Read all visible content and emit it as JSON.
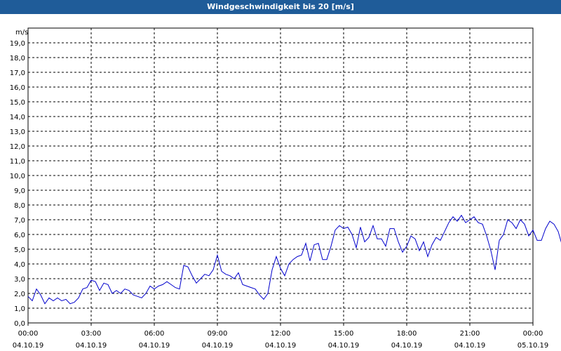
{
  "window": {
    "title": "Windgeschwindigkeit bis 20 [m/s]"
  },
  "colors": {
    "titlebar": "#1f5c99",
    "line": "#0000cc",
    "grid": "#000000"
  },
  "chart_data": {
    "type": "line",
    "title": "Windgeschwindigkeit bis 20 [m/s]",
    "ylabel": "m/s",
    "ylim": [
      0,
      20
    ],
    "y_ticks": [
      "0,0",
      "1,0",
      "2,0",
      "3,0",
      "4,0",
      "5,0",
      "6,0",
      "7,0",
      "8,0",
      "9,0",
      "10,0",
      "11,0",
      "12,0",
      "13,0",
      "14,0",
      "15,0",
      "16,0",
      "17,0",
      "18,0",
      "19,0"
    ],
    "x_range_hours": [
      0,
      24
    ],
    "x_ticks": [
      {
        "time": "00:00",
        "date": "04.10.19"
      },
      {
        "time": "03:00",
        "date": "04.10.19"
      },
      {
        "time": "06:00",
        "date": "04.10.19"
      },
      {
        "time": "09:00",
        "date": "04.10.19"
      },
      {
        "time": "12:00",
        "date": "04.10.19"
      },
      {
        "time": "15:00",
        "date": "04.10.19"
      },
      {
        "time": "18:00",
        "date": "04.10.19"
      },
      {
        "time": "21:00",
        "date": "04.10.19"
      },
      {
        "time": "00:00",
        "date": "05.10.19"
      }
    ],
    "grid": true,
    "series": [
      {
        "values": [
          [
            0.0,
            1.8
          ],
          [
            0.2,
            1.5
          ],
          [
            0.4,
            2.3
          ],
          [
            0.6,
            1.9
          ],
          [
            0.8,
            1.3
          ],
          [
            1.0,
            1.7
          ],
          [
            1.2,
            1.5
          ],
          [
            1.4,
            1.7
          ],
          [
            1.6,
            1.5
          ],
          [
            1.8,
            1.6
          ],
          [
            2.0,
            1.3
          ],
          [
            2.2,
            1.4
          ],
          [
            2.4,
            1.7
          ],
          [
            2.6,
            2.3
          ],
          [
            2.8,
            2.4
          ],
          [
            3.0,
            2.9
          ],
          [
            3.2,
            2.8
          ],
          [
            3.4,
            2.2
          ],
          [
            3.6,
            2.7
          ],
          [
            3.8,
            2.6
          ],
          [
            4.0,
            2.0
          ],
          [
            4.2,
            2.2
          ],
          [
            4.4,
            2.0
          ],
          [
            4.6,
            2.3
          ],
          [
            4.8,
            2.2
          ],
          [
            5.0,
            1.9
          ],
          [
            5.2,
            1.8
          ],
          [
            5.4,
            1.7
          ],
          [
            5.6,
            2.0
          ],
          [
            5.8,
            2.5
          ],
          [
            6.0,
            2.3
          ],
          [
            6.2,
            2.5
          ],
          [
            6.4,
            2.6
          ],
          [
            6.6,
            2.8
          ],
          [
            6.8,
            2.6
          ],
          [
            7.0,
            2.4
          ],
          [
            7.2,
            2.3
          ],
          [
            7.4,
            3.9
          ],
          [
            7.6,
            3.8
          ],
          [
            7.8,
            3.2
          ],
          [
            8.0,
            2.7
          ],
          [
            8.2,
            3.0
          ],
          [
            8.4,
            3.3
          ],
          [
            8.6,
            3.2
          ],
          [
            8.8,
            3.6
          ],
          [
            9.0,
            4.6
          ],
          [
            9.2,
            3.5
          ],
          [
            9.4,
            3.3
          ],
          [
            9.6,
            3.2
          ],
          [
            9.8,
            3.0
          ],
          [
            10.0,
            3.4
          ],
          [
            10.2,
            2.6
          ],
          [
            10.4,
            2.5
          ],
          [
            10.6,
            2.4
          ],
          [
            10.8,
            2.3
          ],
          [
            11.0,
            1.9
          ],
          [
            11.2,
            1.6
          ],
          [
            11.4,
            2.0
          ],
          [
            11.6,
            3.6
          ],
          [
            11.8,
            4.5
          ],
          [
            12.0,
            3.7
          ],
          [
            12.2,
            3.2
          ],
          [
            12.4,
            4.0
          ],
          [
            12.6,
            4.3
          ],
          [
            12.8,
            4.5
          ],
          [
            13.0,
            4.6
          ],
          [
            13.2,
            5.4
          ],
          [
            13.4,
            4.2
          ],
          [
            13.6,
            5.3
          ],
          [
            13.8,
            5.4
          ],
          [
            14.0,
            4.3
          ],
          [
            14.2,
            4.3
          ],
          [
            14.4,
            5.2
          ],
          [
            14.6,
            6.3
          ],
          [
            14.8,
            6.6
          ],
          [
            15.0,
            6.4
          ],
          [
            15.2,
            6.5
          ],
          [
            15.4,
            6.0
          ],
          [
            15.6,
            5.1
          ],
          [
            15.8,
            6.5
          ],
          [
            16.0,
            5.5
          ],
          [
            16.2,
            5.8
          ],
          [
            16.4,
            6.6
          ],
          [
            16.6,
            5.7
          ],
          [
            16.8,
            5.7
          ],
          [
            17.0,
            5.2
          ],
          [
            17.2,
            6.4
          ],
          [
            17.4,
            6.4
          ],
          [
            17.6,
            5.5
          ],
          [
            17.8,
            4.8
          ],
          [
            18.0,
            5.2
          ],
          [
            18.2,
            5.9
          ],
          [
            18.4,
            5.7
          ],
          [
            18.6,
            4.9
          ],
          [
            18.8,
            5.5
          ],
          [
            19.0,
            4.5
          ],
          [
            19.2,
            5.3
          ],
          [
            19.4,
            5.8
          ],
          [
            19.6,
            5.6
          ],
          [
            19.8,
            6.2
          ],
          [
            20.0,
            6.8
          ],
          [
            20.2,
            7.2
          ],
          [
            20.4,
            6.9
          ],
          [
            20.6,
            7.3
          ],
          [
            20.8,
            6.8
          ],
          [
            21.0,
            7.0
          ],
          [
            21.2,
            7.2
          ],
          [
            21.4,
            6.8
          ],
          [
            21.6,
            6.7
          ],
          [
            21.8,
            5.9
          ],
          [
            22.0,
            4.9
          ],
          [
            22.2,
            3.6
          ],
          [
            22.4,
            5.6
          ],
          [
            22.6,
            6.0
          ],
          [
            22.8,
            7.0
          ],
          [
            23.0,
            6.8
          ],
          [
            23.2,
            6.4
          ],
          [
            23.4,
            7.0
          ],
          [
            23.6,
            6.7
          ],
          [
            23.8,
            5.9
          ],
          [
            24.0,
            6.3
          ],
          [
            24.2,
            5.6
          ],
          [
            24.4,
            5.6
          ],
          [
            24.6,
            6.4
          ],
          [
            24.8,
            6.9
          ],
          [
            25.0,
            6.7
          ],
          [
            25.2,
            6.2
          ],
          [
            25.4,
            5.2
          ],
          [
            25.6,
            6.0
          ]
        ]
      }
    ]
  }
}
